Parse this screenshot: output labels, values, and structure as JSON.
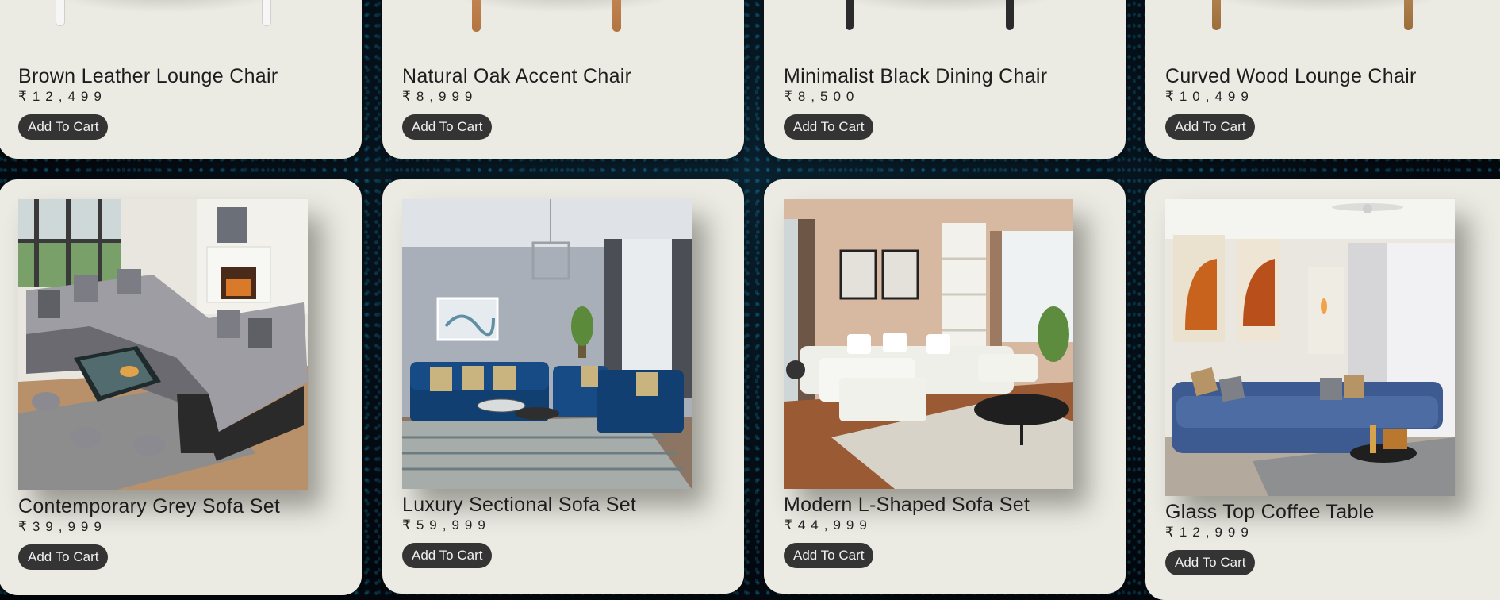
{
  "currency_symbol": "₹",
  "top_row": [
    {
      "title": "Brown Leather Lounge Chair",
      "price": "₹12,499",
      "button": "Add To Cart"
    },
    {
      "title": "Natural Oak Accent Chair",
      "price": "₹8,999",
      "button": "Add To Cart"
    },
    {
      "title": "Minimalist Black Dining Chair",
      "price": "₹8,500",
      "button": "Add To Cart"
    },
    {
      "title": "Curved Wood Lounge Chair",
      "price": "₹10,499",
      "button": "Add To Cart"
    }
  ],
  "bottom_row": [
    {
      "title": "Contemporary Grey Sofa Set",
      "price": "₹39,999",
      "button": "Add To Cart"
    },
    {
      "title": "Luxury Sectional Sofa Set",
      "price": "₹59,999",
      "button": "Add To Cart"
    },
    {
      "title": "Modern L-Shaped Sofa Set",
      "price": "₹44,999",
      "button": "Add To Cart"
    },
    {
      "title": "Glass Top Coffee Table",
      "price": "₹12,999",
      "button": "Add To Cart"
    }
  ],
  "colors": {
    "card_background": "#ebeae3",
    "button_background": "#343434",
    "page_background": "#050b12",
    "accent_dots": "#28aadc"
  }
}
